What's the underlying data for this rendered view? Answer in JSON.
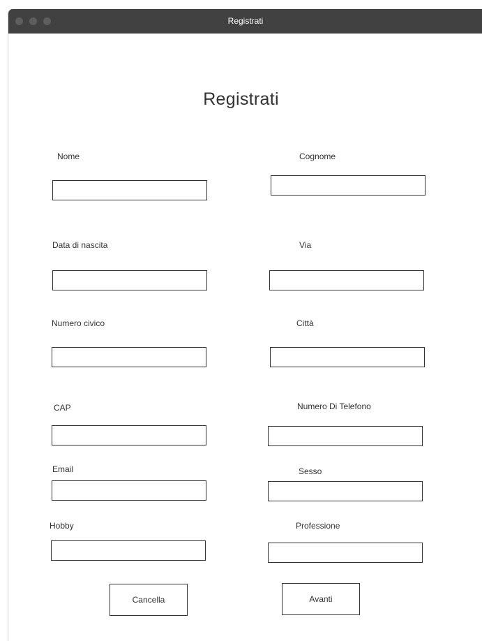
{
  "window": {
    "title": "Registrati"
  },
  "form": {
    "heading": "Registrati",
    "fields": {
      "nome": {
        "label": "Nome",
        "value": ""
      },
      "cognome": {
        "label": "Cognome",
        "value": ""
      },
      "data_nascita": {
        "label": "Data di nascita",
        "value": ""
      },
      "via": {
        "label": "Via",
        "value": ""
      },
      "numero_civico": {
        "label": "Numero civico",
        "value": ""
      },
      "citta": {
        "label": "Città",
        "value": ""
      },
      "cap": {
        "label": "CAP",
        "value": ""
      },
      "telefono": {
        "label": "Numero Di Telefono",
        "value": ""
      },
      "email": {
        "label": "Email",
        "value": ""
      },
      "sesso": {
        "label": "Sesso",
        "value": ""
      },
      "hobby": {
        "label": "Hobby",
        "value": ""
      },
      "professione": {
        "label": "Professione",
        "value": ""
      }
    },
    "buttons": {
      "cancel": "Cancella",
      "next": "Avanti"
    }
  }
}
